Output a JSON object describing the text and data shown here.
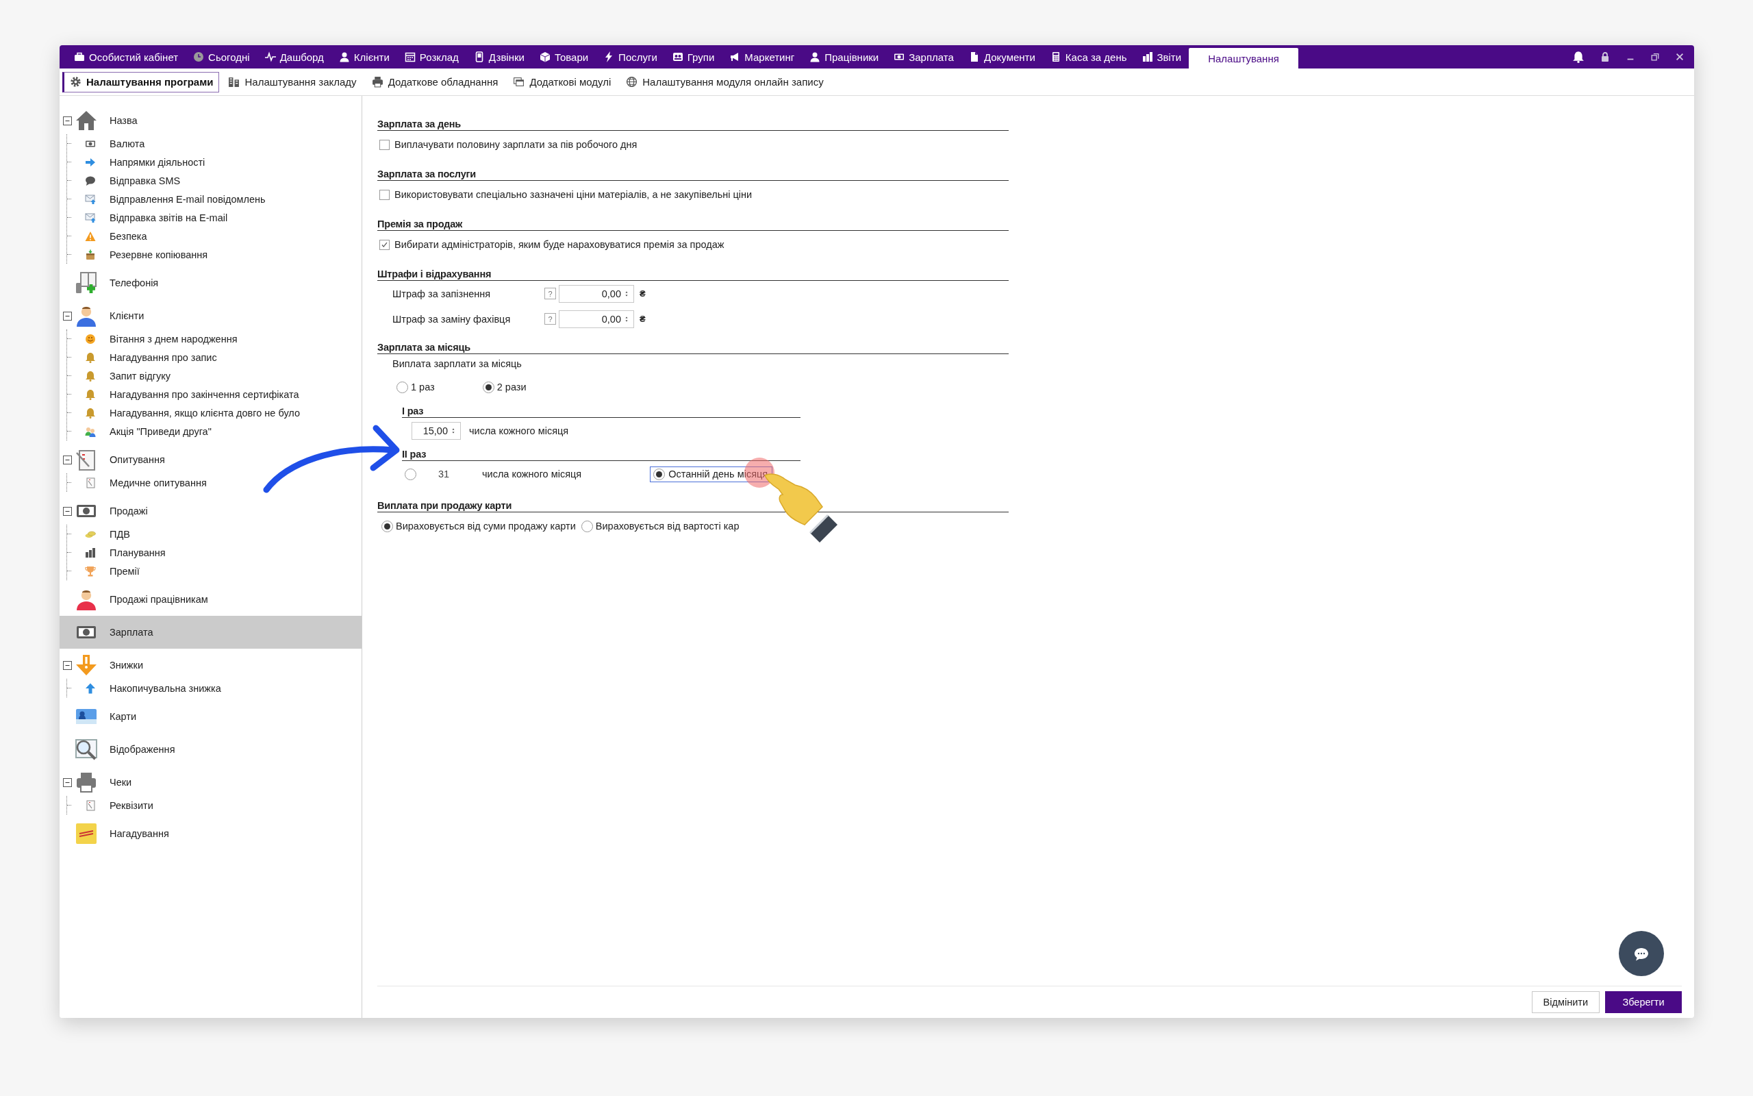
{
  "top_nav": {
    "items": [
      {
        "label": "Особистий кабінет",
        "selected": false
      },
      {
        "label": "Сьогодні",
        "selected": false
      },
      {
        "label": "Дашборд",
        "selected": false
      },
      {
        "label": "Клієнти",
        "selected": false
      },
      {
        "label": "Розклад",
        "selected": false
      },
      {
        "label": "Дзвінки",
        "selected": false
      },
      {
        "label": "Товари",
        "selected": false
      },
      {
        "label": "Послуги",
        "selected": false
      },
      {
        "label": "Групи",
        "selected": false
      },
      {
        "label": "Маркетинг",
        "selected": false
      },
      {
        "label": "Працівники",
        "selected": false
      },
      {
        "label": "Зарплата",
        "selected": false
      },
      {
        "label": "Документи",
        "selected": false
      },
      {
        "label": "Каса за день",
        "selected": false
      },
      {
        "label": "Звіти",
        "selected": false
      },
      {
        "label": "Налаштування",
        "selected": true
      }
    ]
  },
  "sub_tabs": [
    {
      "label": "Налаштування програми",
      "selected": true
    },
    {
      "label": "Налаштування закладу",
      "selected": false
    },
    {
      "label": "Додаткове обладнання",
      "selected": false
    },
    {
      "label": "Додаткові модулі",
      "selected": false
    },
    {
      "label": "Налаштування модуля онлайн запису",
      "selected": false
    }
  ],
  "sidebar": {
    "items": [
      {
        "label": "Назва",
        "selected": false,
        "expanded": true,
        "children": [
          {
            "label": "Валюта",
            "selected": false
          },
          {
            "label": "Напрямки діяльності",
            "selected": false
          },
          {
            "label": "Відправка SMS",
            "selected": false
          },
          {
            "label": "Відправлення E-mail повідомлень",
            "selected": false
          },
          {
            "label": "Відправка звітів на E-mail",
            "selected": false
          },
          {
            "label": "Безпека",
            "selected": false
          },
          {
            "label": "Резервне копіювання",
            "selected": false
          }
        ]
      },
      {
        "label": "Телефонія",
        "selected": false
      },
      {
        "label": "Клієнти",
        "selected": false,
        "expanded": true,
        "children": [
          {
            "label": "Вітання з днем народження",
            "selected": false
          },
          {
            "label": "Нагадування про запис",
            "selected": false
          },
          {
            "label": "Запит відгуку",
            "selected": false
          },
          {
            "label": "Нагадування про закінчення сертифіката",
            "selected": false
          },
          {
            "label": "Нагадування, якщо клієнта довго не було",
            "selected": false
          },
          {
            "label": "Акція \"Приведи друга\"",
            "selected": false
          }
        ]
      },
      {
        "label": "Опитування",
        "selected": false,
        "expanded": true,
        "children": [
          {
            "label": "Медичне опитування",
            "selected": false
          }
        ]
      },
      {
        "label": "Продажі",
        "selected": false,
        "expanded": true,
        "children": [
          {
            "label": "ПДВ",
            "selected": false
          },
          {
            "label": "Планування",
            "selected": false
          },
          {
            "label": "Премії",
            "selected": false
          }
        ]
      },
      {
        "label": "Продажі працівникам",
        "selected": false
      },
      {
        "label": "Зарплата",
        "selected": true
      },
      {
        "label": "Знижки",
        "selected": false,
        "expanded": true,
        "children": [
          {
            "label": "Накопичувальна знижка",
            "selected": false
          }
        ]
      },
      {
        "label": "Карти",
        "selected": false
      },
      {
        "label": "Відображення",
        "selected": false
      },
      {
        "label": "Чеки",
        "selected": false,
        "expanded": true,
        "children": [
          {
            "label": "Реквізити",
            "selected": false
          }
        ]
      },
      {
        "label": "Нагадування",
        "selected": false
      }
    ]
  },
  "sections": [
    {
      "title": "Зарплата за день",
      "rows": [
        {
          "kind": "checkbox",
          "label": "Виплачувати половину зарплати за пів робочого дня",
          "checked": false
        }
      ]
    },
    {
      "title": "Зарплата за послуги",
      "rows": [
        {
          "kind": "checkbox",
          "label": "Використовувати спеціально зазначені ціни матеріалів, а не закупівельні ціни",
          "checked": false
        }
      ]
    },
    {
      "title": "Премія за продаж",
      "rows": [
        {
          "kind": "checkbox",
          "label": "Вибирати адміністраторів, яким буде нараховуватися премія за продаж",
          "checked": true
        }
      ]
    },
    {
      "title": "Штрафи і відрахування",
      "rows": [
        {
          "kind": "amount",
          "label": "Штраф за запізнення",
          "help": "?",
          "value": "0,00",
          "unit": "₴"
        },
        {
          "kind": "amount",
          "label": "Штраф за заміну фахівця",
          "help": "?",
          "value": "0,00",
          "unit": "₴"
        }
      ]
    },
    {
      "title": "Зарплата за місяць",
      "rows": [
        {
          "kind": "caption",
          "label": "Виплата зарплати за місяць"
        },
        {
          "kind": "radios",
          "options": [
            {
              "label": "1 раз",
              "selected": false
            },
            {
              "label": "2 рази",
              "selected": true
            }
          ]
        }
      ],
      "subsections": [
        {
          "title": "I раз",
          "rows": [
            {
              "kind": "day",
              "value": "15,00",
              "suffix": "числа кожного місяця"
            }
          ]
        },
        {
          "title": "II раз",
          "rows": [
            {
              "kind": "day-choice",
              "options": [
                {
                  "value": "31",
                  "suffix": "числа кожного місяця",
                  "selected": false
                },
                {
                  "label": "Останній день місяця",
                  "selected": true
                }
              ]
            }
          ]
        }
      ]
    },
    {
      "title": "Виплата при продажу карти",
      "rows": [
        {
          "kind": "radios",
          "options": [
            {
              "label": "Вираховується від суми продажу карти",
              "selected": true
            },
            {
              "label": "Вираховується від вартості кар",
              "selected": false
            }
          ]
        }
      ]
    }
  ],
  "buttons": [
    {
      "label": "Відмінити",
      "kind": "secondary"
    },
    {
      "label": "Зберегти",
      "kind": "primary"
    }
  ]
}
